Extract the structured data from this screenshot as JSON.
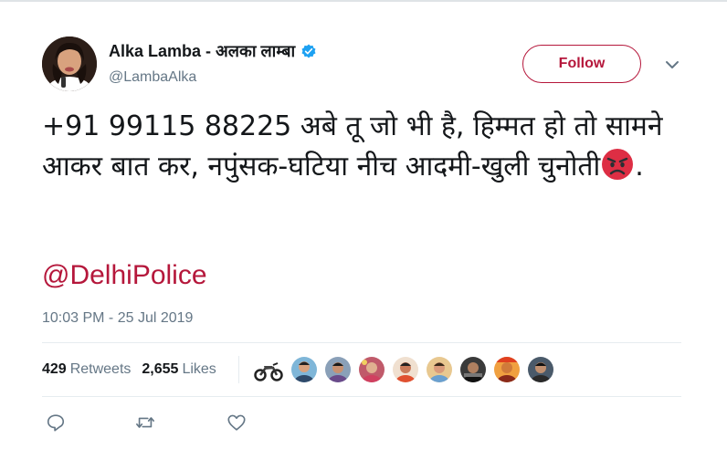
{
  "tweet": {
    "author": {
      "display_name": "Alka Lamba - अलका लाम्बा",
      "handle": "@LambaAlka",
      "verified": true
    },
    "follow_label": "Follow",
    "text_before_emoji": "+91 99115 88225 अबे तू जो भी है, हिम्मत हो तो सामने आकर बात कर, नपुंसक-घटिया नीच आदमी-खुली चुनोती",
    "emoji": "angry-face",
    "text_after_emoji": ".",
    "mention": "@DelhiPolice",
    "timestamp": "10:03 PM - 25 Jul 2019",
    "stats": {
      "retweets_count": "429",
      "retweets_label": "Retweets",
      "likes_count": "2,655",
      "likes_label": "Likes"
    }
  },
  "colors": {
    "accent": "#b5173b",
    "verified": "#1da1f2",
    "secondary_text": "#657786",
    "primary_text": "#14171a",
    "divider": "#e6ecf0"
  },
  "icons": {
    "more": "chevron-down-icon",
    "reply": "reply-icon",
    "retweet": "retweet-icon",
    "like": "heart-icon"
  },
  "likers": [
    {
      "avatar": "motorcycle",
      "color": "#5a5a5a"
    },
    {
      "avatar": "person",
      "color": "#7fb6d8"
    },
    {
      "avatar": "person",
      "color": "#8aa0b8"
    },
    {
      "avatar": "person",
      "color": "#c05a6a"
    },
    {
      "avatar": "person",
      "color": "#c97a5a"
    },
    {
      "avatar": "person",
      "color": "#d99a7a"
    },
    {
      "avatar": "person",
      "color": "#3a3a3a"
    },
    {
      "avatar": "person",
      "color": "#d07a3a"
    },
    {
      "avatar": "person",
      "color": "#4a5a6a"
    }
  ]
}
